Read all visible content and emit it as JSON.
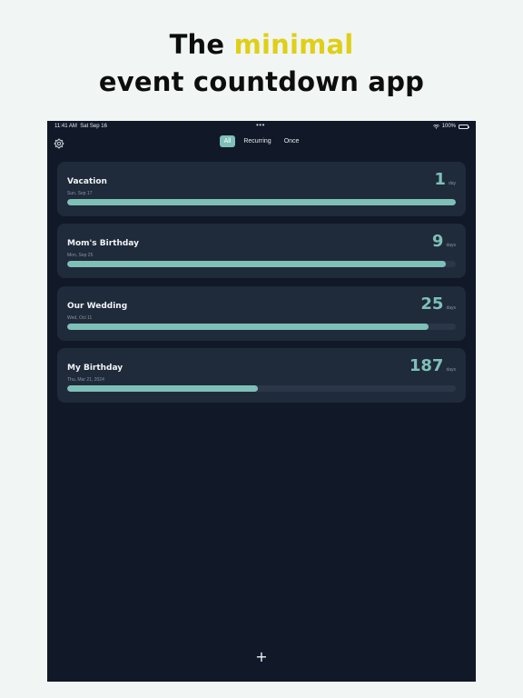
{
  "headline": {
    "line1_prefix": "The ",
    "line1_accent": "minimal",
    "line2": "event countdown app"
  },
  "status_bar": {
    "time": "11:41 AM",
    "date": "Sat Sep 16",
    "battery": "100%"
  },
  "toolbar": {
    "settings_icon": "gear-icon",
    "segments": [
      {
        "label": "All",
        "active": true
      },
      {
        "label": "Recurring",
        "active": false
      },
      {
        "label": "Once",
        "active": false
      }
    ]
  },
  "events": [
    {
      "title": "Vacation",
      "date": "Sun, Sep 17",
      "count": "1",
      "unit": "day",
      "progress": 1.0
    },
    {
      "title": "Mom's Birthday",
      "date": "Mon, Sep 25",
      "count": "9",
      "unit": "days",
      "progress": 0.975
    },
    {
      "title": "Our Wedding",
      "date": "Wed, Oct 11",
      "count": "25",
      "unit": "days",
      "progress": 0.93
    },
    {
      "title": "My Birthday",
      "date": "Thu, Mar 21, 2024",
      "count": "187",
      "unit": "days",
      "progress": 0.49
    }
  ],
  "add_button": {
    "label": "+"
  },
  "colors": {
    "accent": "#7ec0b8",
    "background": "#111827",
    "card": "#1f2a3a",
    "headline_accent": "#dfcf17"
  }
}
